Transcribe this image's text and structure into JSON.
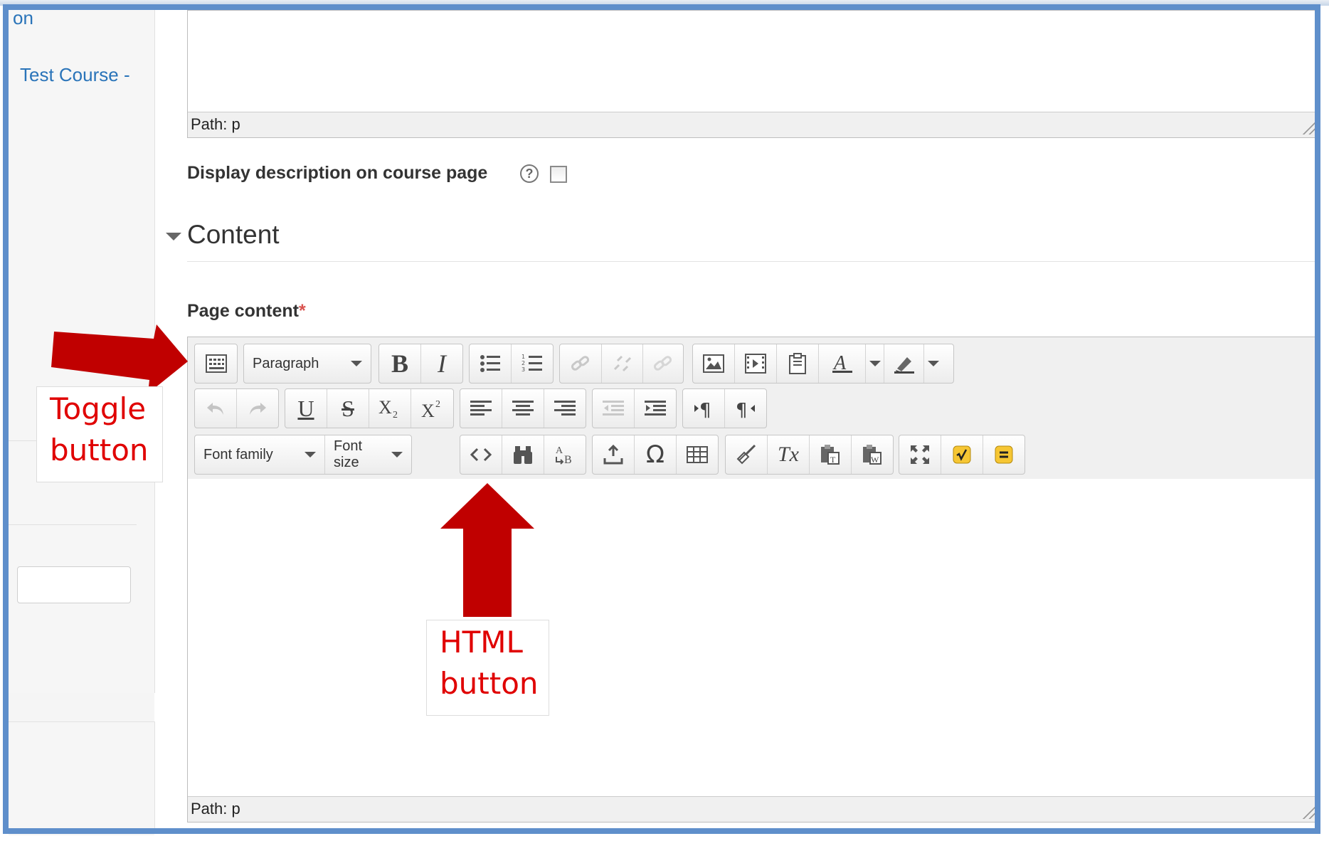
{
  "sidebar": {
    "top_fragment": "on",
    "course_link": "Test Course -"
  },
  "description_editor": {
    "path_label": "Path: p"
  },
  "display_description": {
    "label": "Display description on course page",
    "help_glyph": "?",
    "checked": false
  },
  "content_section": {
    "title": "Content",
    "page_content_label": "Page content",
    "required_marker": "*"
  },
  "toolbar": {
    "paragraph_select": "Paragraph",
    "font_family_select": "Font family",
    "font_size_select": "Font size",
    "bold": "B",
    "italic": "I",
    "underline": "U",
    "strikethrough": "S",
    "omega": "Ω",
    "clear_format": "Tx"
  },
  "content_editor": {
    "path_label": "Path: p"
  },
  "annotations": {
    "toggle_line1": "Toggle",
    "toggle_line2": "button",
    "html_line1": "HTML",
    "html_line2": "button"
  },
  "colors": {
    "arrow": "#c00000",
    "annotation_text": "#e00000",
    "frame": "#5f8fcb",
    "link": "#2a74b9"
  }
}
